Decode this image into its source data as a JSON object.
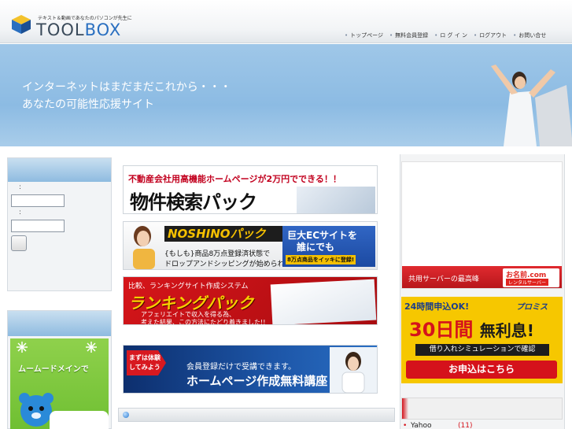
{
  "header": {
    "tagline": "テキスト＆動画であなたのパソコンが先生に",
    "brand_left": "TOOL",
    "brand_right": "BOX",
    "nav": [
      "トップページ",
      "無料会員登録",
      "ロ グ イ ン",
      "ログアウト",
      "お問い合せ"
    ]
  },
  "hero": {
    "line1": "インターネットはまだまだこれから・・・",
    "line2": "あなたの可能性応援サイト"
  },
  "login": {
    "label1": ":",
    "label2": ":",
    "field1_value": "",
    "field2_value": ""
  },
  "side": {
    "moomoo_text": "ムームードメインで"
  },
  "banners": {
    "b1": {
      "headline": "不動産会社用高機能ホームページが2万円でできる！！",
      "title": "物件検索パック"
    },
    "b2": {
      "title": "NOSHINOパック",
      "line1": "{もしも}商品8万点登録済状態で",
      "line2": "ドロップアンドシッピングが始められる",
      "box_line1": "巨大ECサイトを",
      "box_line2": "誰にでも",
      "box_tag": "8万点商品をイッキに登録!"
    },
    "b3": {
      "subtitle": "比較、ランキングサイト作成システム",
      "title": "ランキングパック",
      "line1": "アフェリエイトで収入を得る為、",
      "line2": "考えた結果、この方法にたどり着きました!!"
    },
    "b4": {
      "arrow": "まずは体験してみよう",
      "line1": "会員登録だけで受講できます。",
      "line2": "ホームページ作成無料講座"
    }
  },
  "right": {
    "ad1_footer": "共用サーバーの最高峰",
    "ad1_logo": "お名前.com",
    "ad1_logo_sub": "レンタルサーバー",
    "ad2_top": "24時間申込OK!",
    "ad2_brand": "プロミス",
    "ad2_big": "30日間",
    "ad2_big_tail": "無利息!",
    "ad2_sim": "借り入れシミュレーションで確認",
    "ad2_apply": "お申込はこちら",
    "ranking": [
      {
        "bullet": "•",
        "name": "Yahoo",
        "count": "(11)"
      }
    ]
  },
  "colors": {
    "accent_red": "#d5121b",
    "brand_blue": "#2a6fc0",
    "hero_sky": "#8cbbe3"
  }
}
